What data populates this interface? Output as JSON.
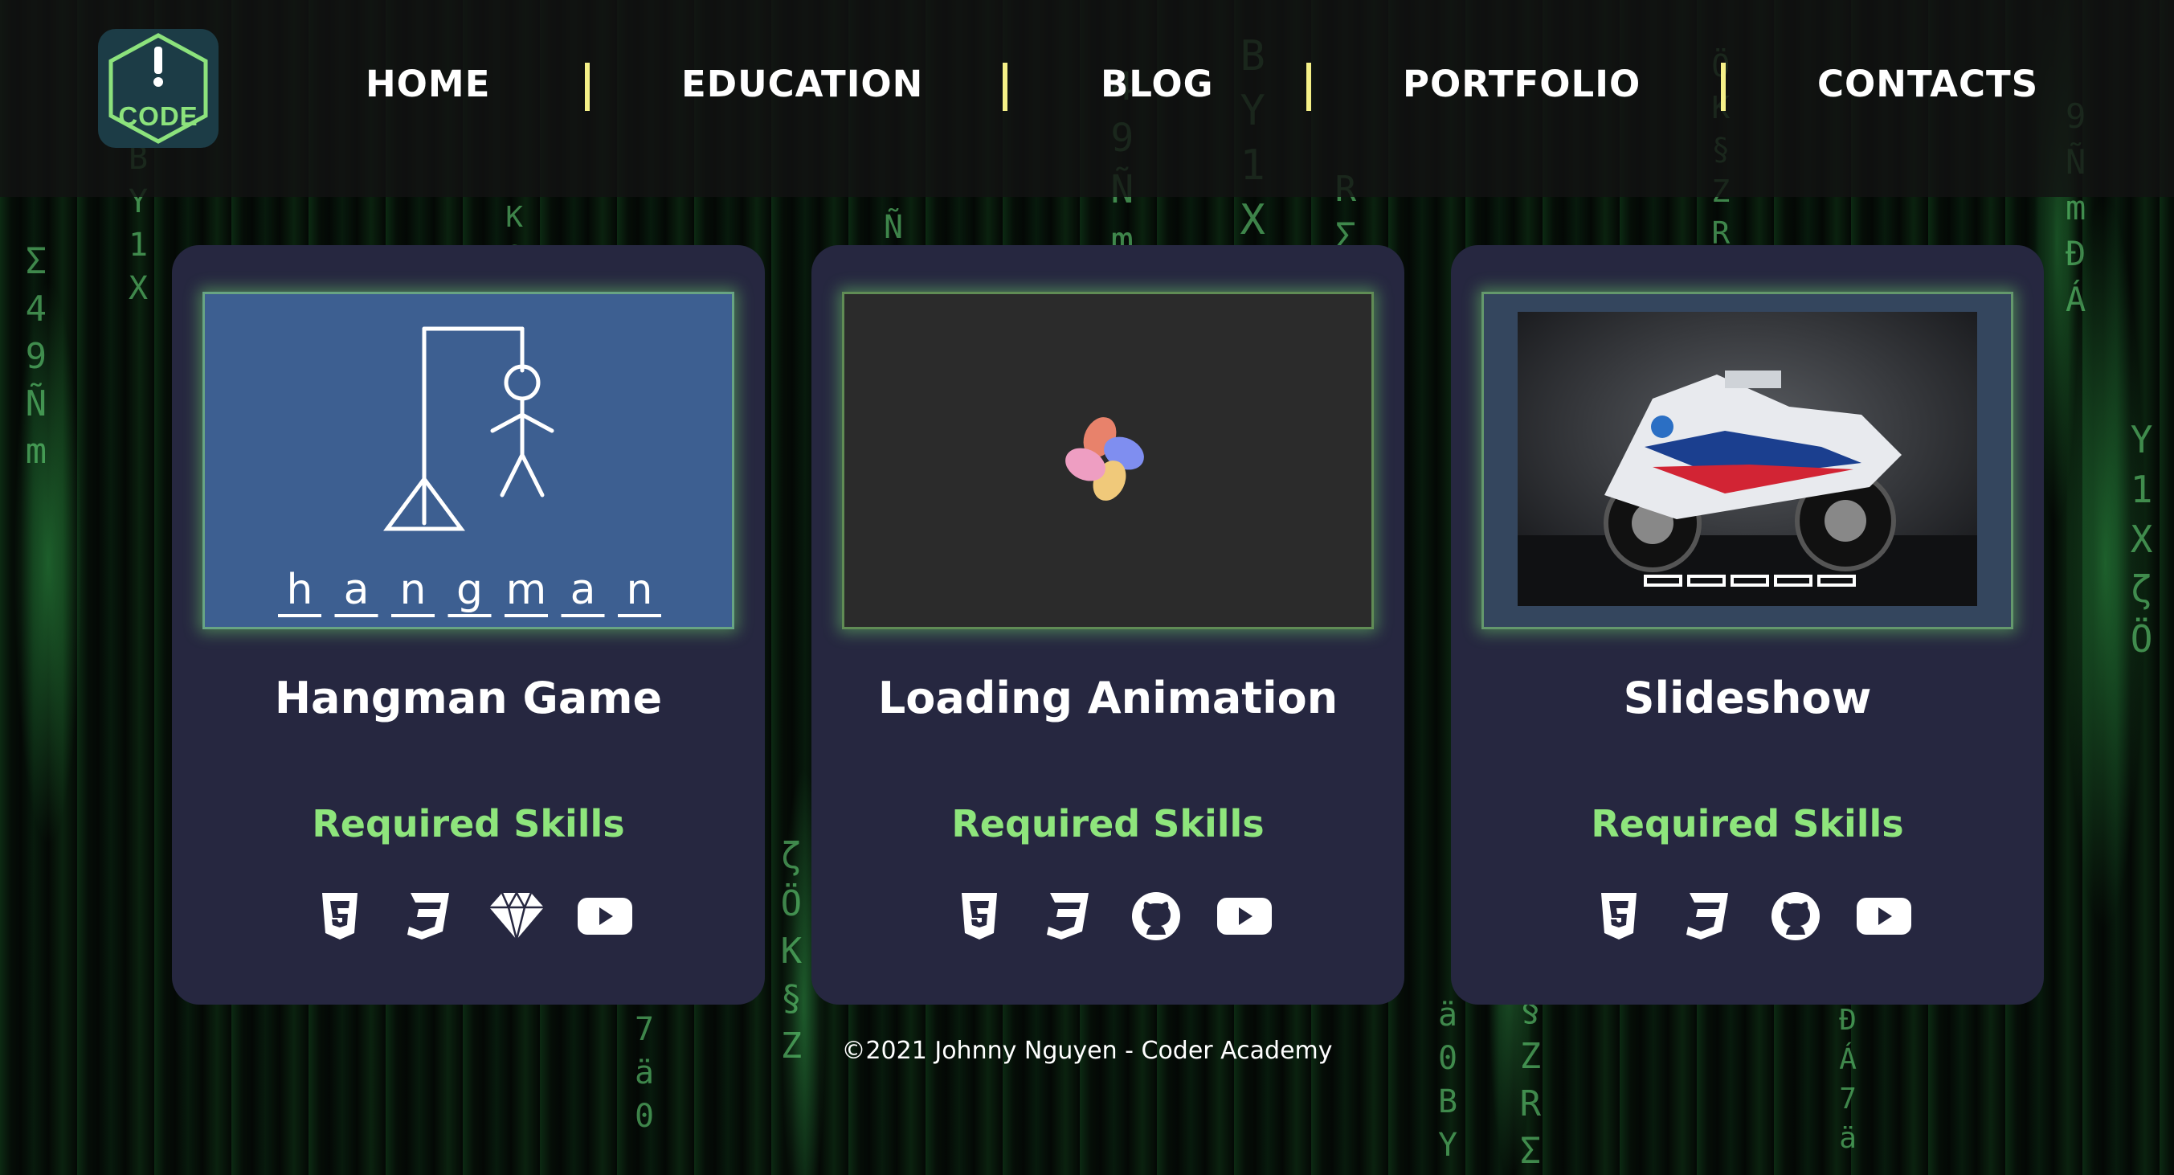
{
  "logo": {
    "text": "CODE",
    "symbol": "!"
  },
  "nav": {
    "items": [
      {
        "label": "HOME"
      },
      {
        "label": "EDUCATION"
      },
      {
        "label": "BLOG"
      },
      {
        "label": "PORTFOLIO"
      },
      {
        "label": "CONTACTS"
      }
    ],
    "separator_color": "#f5f088"
  },
  "projects": [
    {
      "title": "Hangman Game",
      "skills_title": "Required Skills",
      "thumbnail": {
        "word": "hangman",
        "letters": [
          "h",
          "a",
          "n",
          "g",
          "m",
          "a",
          "n"
        ],
        "bg": "#3d5f91"
      },
      "skills": [
        "html5-icon",
        "css3-icon",
        "sketch-icon",
        "youtube-icon"
      ]
    },
    {
      "title": "Loading Animation",
      "skills_title": "Required Skills",
      "thumbnail": {
        "bg": "#2b2b2b",
        "petal_colors": [
          "#e8826b",
          "#7f8ef0",
          "#f0c97a",
          "#ee9ec2"
        ]
      },
      "skills": [
        "html5-icon",
        "css3-icon",
        "github-icon",
        "youtube-icon"
      ]
    },
    {
      "title": "Slideshow",
      "skills_title": "Required Skills",
      "thumbnail": {
        "bg": "#34465e",
        "slide_count": 5
      },
      "skills": [
        "html5-icon",
        "css3-icon",
        "github-icon",
        "youtube-icon"
      ]
    }
  ],
  "footer": {
    "text": "©2021 Johnny Nguyen - Coder Academy"
  },
  "colors": {
    "accent_green": "#8ee57c",
    "card_bg": "#262740"
  }
}
